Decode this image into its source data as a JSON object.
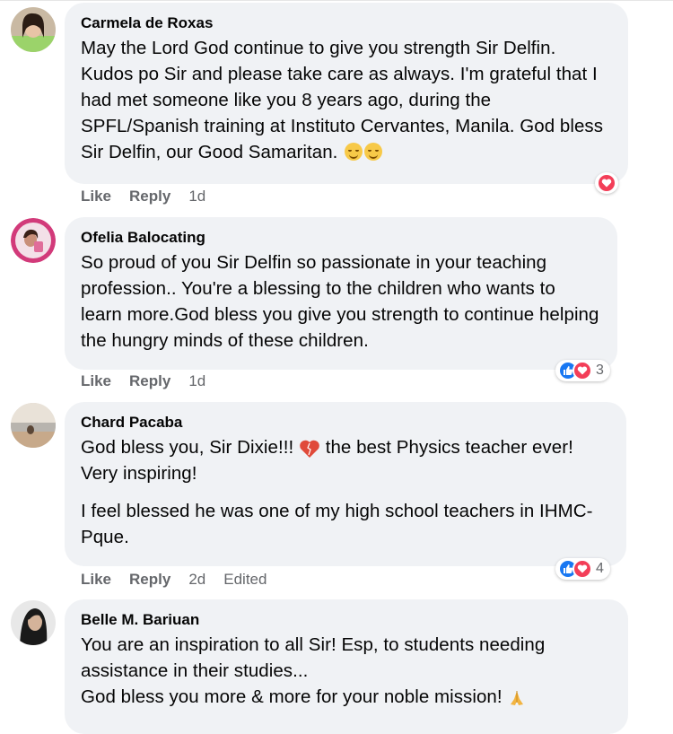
{
  "comments": [
    {
      "author": "Carmela de Roxas",
      "paragraphs": [
        "May the Lord God continue to give you strength Sir Delfin. Kudos po Sir and please take care as always. I'm grateful that I had met someone like you 8 years ago, during the SPFL/Spanish training at Instituto Cervantes, Manila. God bless Sir Delfin, our Good Samaritan."
      ],
      "trailing_emoji": "relieved-face-icon ×2",
      "like_label": "Like",
      "reply_label": "Reply",
      "time": "1d",
      "reactions": {
        "icons": [
          "love-icon"
        ],
        "count": ""
      }
    },
    {
      "author": "Ofelia Balocating",
      "paragraphs": [
        "So proud of you Sir Delfin so passionate in your teaching profession.. You're a blessing to the children who wants to learn more.God bless you give you strength to continue helping the hungry minds of these children."
      ],
      "like_label": "Like",
      "reply_label": "Reply",
      "time": "1d",
      "reactions": {
        "icons": [
          "like-icon",
          "love-icon"
        ],
        "count": "3"
      }
    },
    {
      "author": "Chard Pacaba",
      "text_before_emoji": "God bless you, Sir Dixie!!!",
      "text_after_emoji": "the best Physics teacher ever! Very inspiring!",
      "second_paragraph": "I feel blessed he was one of my high school teachers in IHMC- Pque.",
      "like_label": "Like",
      "reply_label": "Reply",
      "time": "2d",
      "edited_label": "Edited",
      "reactions": {
        "icons": [
          "like-icon",
          "love-icon"
        ],
        "count": "4"
      }
    },
    {
      "author": "Belle M. Bariuan",
      "lines": [
        "You are an inspiration to all Sir! Esp, to students needing assistance in their studies...",
        "God bless you more & more for your noble mission!"
      ]
    }
  ],
  "colors": {
    "bubble": "#f0f2f5",
    "meta": "#65676b",
    "like_blue": "#1877f2",
    "love_red": "#f33e58"
  }
}
